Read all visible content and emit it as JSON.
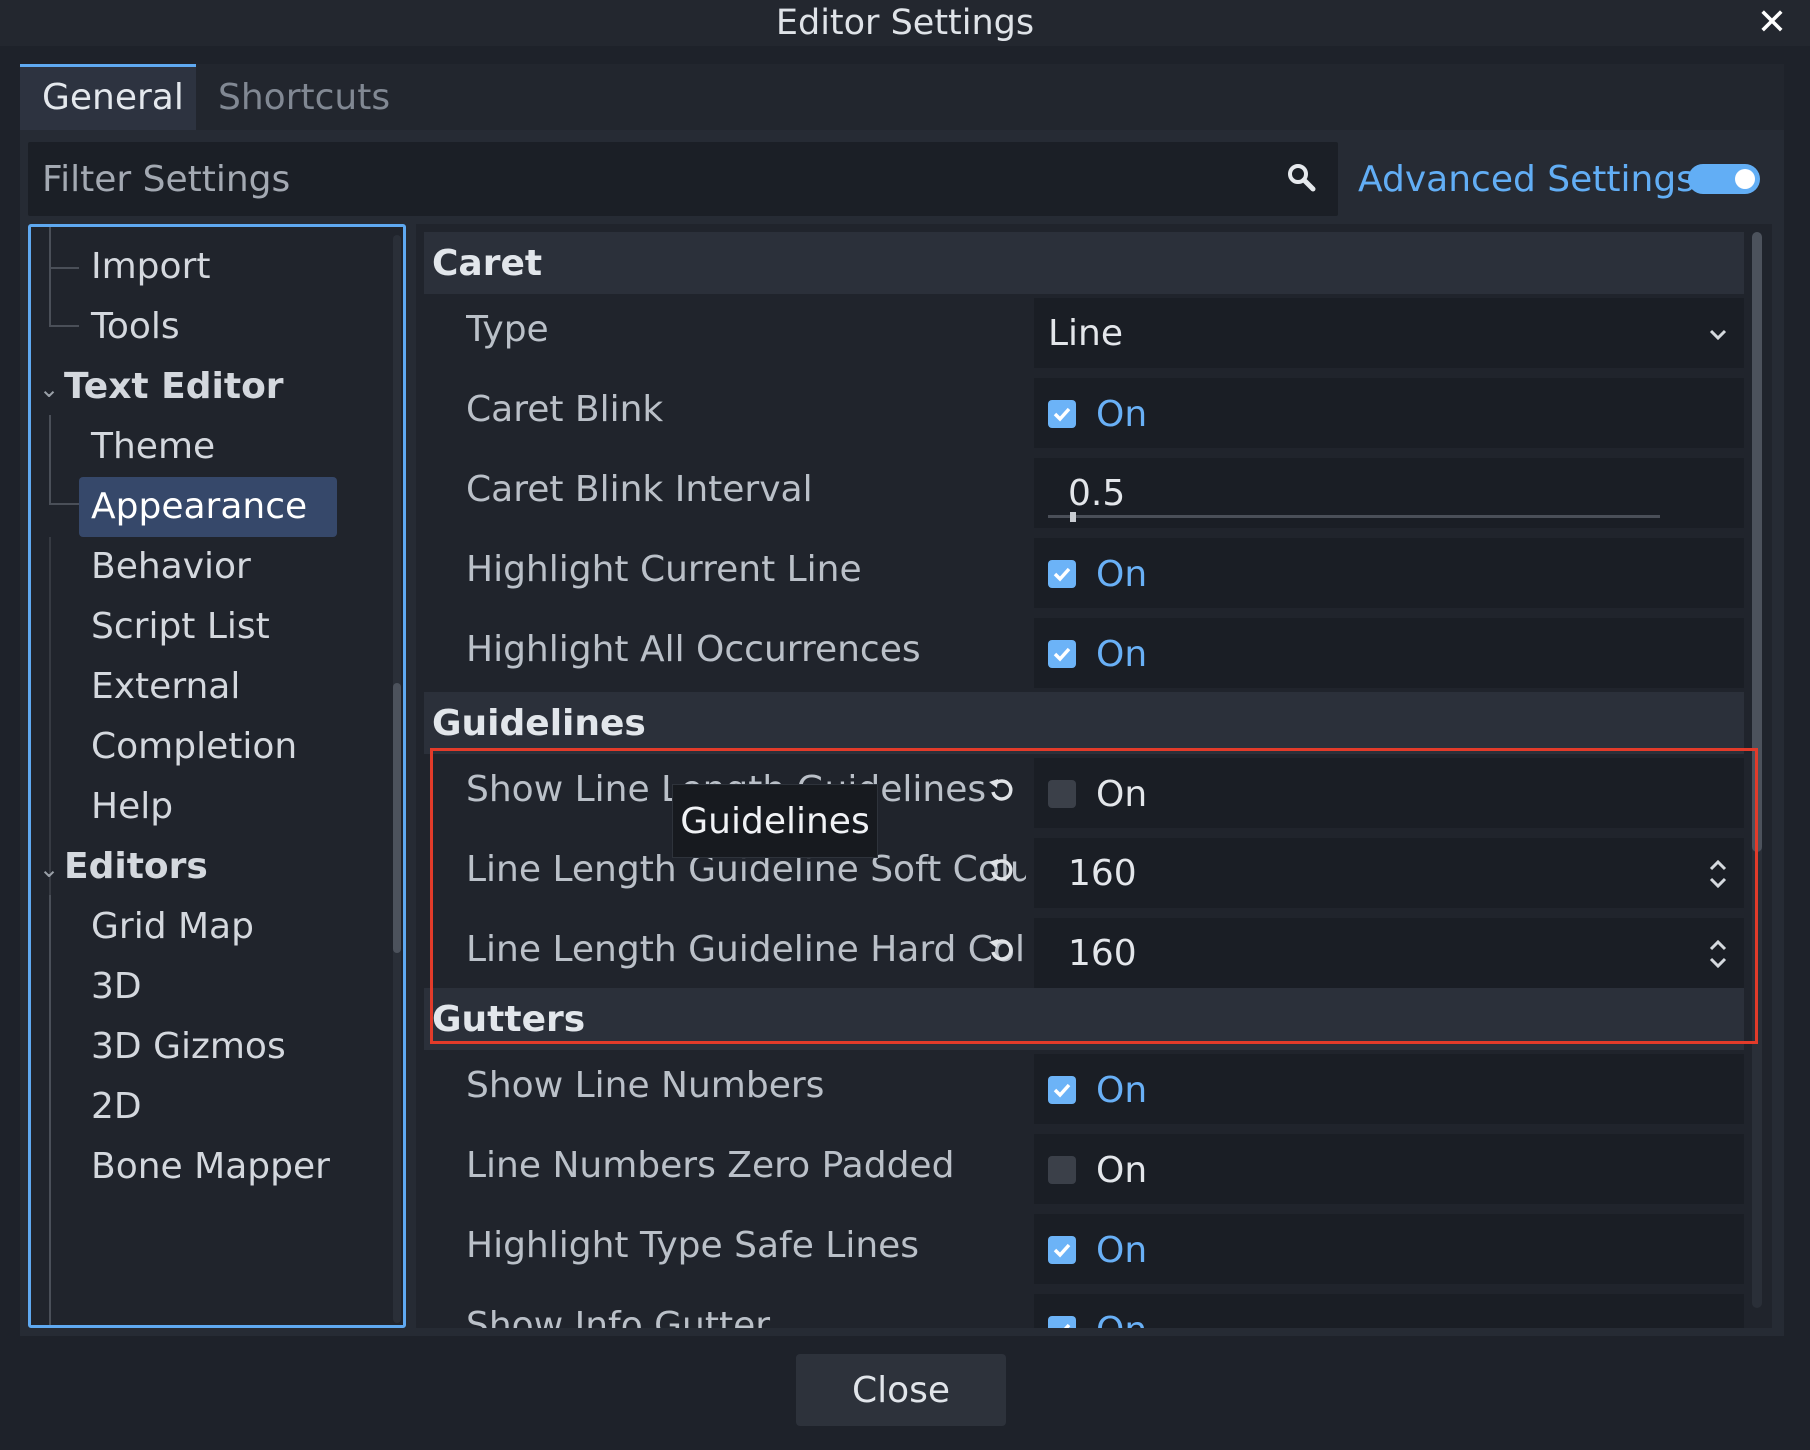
{
  "window": {
    "title": "Editor Settings",
    "close_glyph": "✕"
  },
  "tabs": [
    {
      "label": "General"
    },
    {
      "label": "Shortcuts"
    }
  ],
  "filter": {
    "placeholder": "Filter Settings"
  },
  "advanced": {
    "label": "Advanced Settings",
    "enabled": true
  },
  "tree": {
    "items": [
      {
        "label": "Import"
      },
      {
        "label": "Tools"
      },
      {
        "label": "Text Editor"
      },
      {
        "label": "Theme"
      },
      {
        "label": "Appearance"
      },
      {
        "label": "Behavior"
      },
      {
        "label": "Script List"
      },
      {
        "label": "External"
      },
      {
        "label": "Completion"
      },
      {
        "label": "Help"
      },
      {
        "label": "Editors"
      },
      {
        "label": "Grid Map"
      },
      {
        "label": "3D"
      },
      {
        "label": "3D Gizmos"
      },
      {
        "label": "2D"
      },
      {
        "label": "Bone Mapper"
      }
    ]
  },
  "inspector": {
    "caret": {
      "title": "Caret",
      "type_label": "Type",
      "type_value": "Line",
      "blink_label": "Caret Blink",
      "blink_value": "On",
      "interval_label": "Caret Blink Interval",
      "interval_value": "0.5",
      "highlight_line_label": "Highlight Current Line",
      "highlight_line_value": "On",
      "highlight_occ_label": "Highlight All Occurrences",
      "highlight_occ_value": "On"
    },
    "guidelines": {
      "title": "Guidelines",
      "show_label": "Show Line Length Guidelines",
      "show_value": "On",
      "soft_label": "Line Length Guideline Soft Colum",
      "soft_value": "160",
      "hard_label": "Line Length Guideline Hard Colu",
      "hard_value": "160"
    },
    "gutters": {
      "title": "Gutters",
      "line_numbers_label": "Show Line Numbers",
      "line_numbers_value": "On",
      "zero_padded_label": "Line Numbers Zero Padded",
      "zero_padded_value": "On",
      "type_safe_label": "Highlight Type Safe Lines",
      "type_safe_value": "On",
      "info_gutter_label": "Show Info Gutter",
      "info_gutter_value": "On"
    }
  },
  "tooltip": {
    "text": "Guidelines"
  },
  "footer": {
    "close_label": "Close"
  },
  "colors": {
    "accent": "#62aef5",
    "annotation": "#e23b2a"
  }
}
